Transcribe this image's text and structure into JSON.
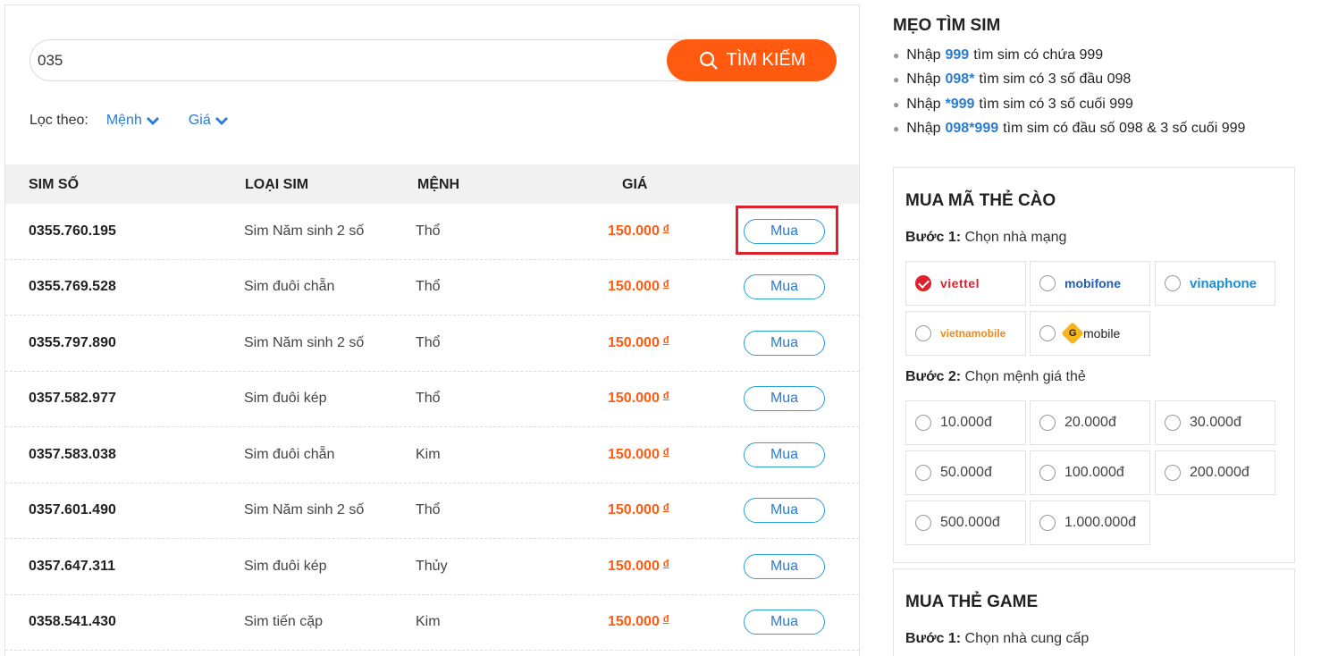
{
  "search": {
    "value": "035",
    "button_label": "TÌM KIẾM"
  },
  "filter": {
    "label": "Lọc theo:",
    "items": [
      {
        "label": "Mệnh"
      },
      {
        "label": "Giá"
      }
    ]
  },
  "table": {
    "headers": [
      "SIM SỐ",
      "LOẠI SIM",
      "MỆNH",
      "GIÁ"
    ],
    "buy_label": "Mua",
    "currency": "đ",
    "rows": [
      {
        "number": "0355.760.195",
        "type": "Sim Năm sinh 2 số",
        "menh": "Thổ",
        "price": "150.000"
      },
      {
        "number": "0355.769.528",
        "type": "Sim đuôi chẵn",
        "menh": "Thổ",
        "price": "150.000"
      },
      {
        "number": "0355.797.890",
        "type": "Sim Năm sinh 2 số",
        "menh": "Thổ",
        "price": "150.000"
      },
      {
        "number": "0357.582.977",
        "type": "Sim đuôi kép",
        "menh": "Thổ",
        "price": "150.000"
      },
      {
        "number": "0357.583.038",
        "type": "Sim đuôi chẵn",
        "menh": "Kim",
        "price": "150.000"
      },
      {
        "number": "0357.601.490",
        "type": "Sim Năm sinh 2 số",
        "menh": "Thổ",
        "price": "150.000"
      },
      {
        "number": "0357.647.311",
        "type": "Sim đuôi kép",
        "menh": "Thủy",
        "price": "150.000"
      },
      {
        "number": "0358.541.430",
        "type": "Sim tiến cặp",
        "menh": "Kim",
        "price": "150.000"
      }
    ]
  },
  "tips": {
    "title": "MẸO TÌM SIM",
    "items": [
      {
        "pre": "Nhập",
        "code": "999",
        "post": "tìm sim có chứa 999"
      },
      {
        "pre": "Nhập",
        "code": "098*",
        "post": "tìm sim có 3 số đầu 098"
      },
      {
        "pre": "Nhập",
        "code": "*999",
        "post": "tìm sim có 3 số cuối 999"
      },
      {
        "pre": "Nhập",
        "code": "098*999",
        "post": "tìm sim có đầu số 098 & 3 số cuối 999"
      }
    ]
  },
  "card_box": {
    "title": "MUA MÃ THẺ CÀO",
    "step1_label": "Bước 1:",
    "step1_text": "Chọn nhà mạng",
    "networks": [
      {
        "name": "viettel",
        "checked": true
      },
      {
        "name": "mobifone",
        "checked": false
      },
      {
        "name": "vinaphone",
        "checked": false
      },
      {
        "name": "vietnamobile",
        "checked": false
      },
      {
        "name": "mobile",
        "checked": false
      }
    ],
    "step2_label": "Bước 2:",
    "step2_text": "Chọn mệnh giá thẻ",
    "values": [
      "10.000đ",
      "20.000đ",
      "30.000đ",
      "50.000đ",
      "100.000đ",
      "200.000đ",
      "500.000đ",
      "1.000.000đ"
    ]
  },
  "game_box": {
    "title": "MUA THẺ GAME",
    "step1_label": "Bước 1:",
    "step1_text": "Chọn nhà cung cấp"
  },
  "colors": {
    "accent": "#ff5a10",
    "link": "#2a7bd3",
    "highlight": "#e0202a"
  }
}
